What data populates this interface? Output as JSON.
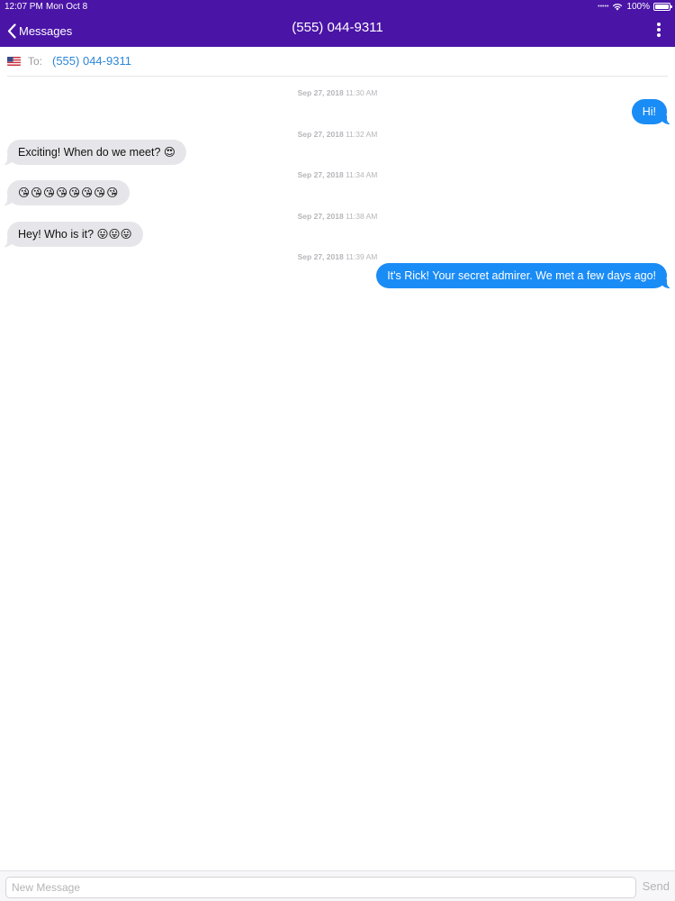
{
  "status_bar": {
    "time": "12:07 PM",
    "date": "Mon Oct 8",
    "battery": "100%"
  },
  "nav": {
    "back_label": "Messages",
    "title": "(555) 044-9311"
  },
  "recipient": {
    "to_label": "To:",
    "value": "(555) 044-9311"
  },
  "messages": [
    {
      "date": "Sep 27, 2018",
      "time": "11:30 AM",
      "direction": "outgoing",
      "text": "Hi!"
    },
    {
      "date": "Sep 27, 2018",
      "time": "11:32 AM",
      "direction": "incoming",
      "text": "Exciting! When do we meet? 😍"
    },
    {
      "date": "Sep 27, 2018",
      "time": "11:34 AM",
      "direction": "incoming",
      "text": "😘😘😘😘😘😘😘😘"
    },
    {
      "date": "Sep 27, 2018",
      "time": "11:38 AM",
      "direction": "incoming",
      "text": "Hey! Who is it? 😛😛😛"
    },
    {
      "date": "Sep 27, 2018",
      "time": "11:39 AM",
      "direction": "outgoing",
      "text": "It's Rick! Your secret admirer. We met a few days ago!"
    }
  ],
  "compose": {
    "placeholder": "New Message",
    "send_label": "Send"
  },
  "colors": {
    "header": "#4a14a6",
    "outgoing_bubble": "#1a8cf6",
    "incoming_bubble": "#e6e6ea",
    "link": "#2e86d8"
  }
}
